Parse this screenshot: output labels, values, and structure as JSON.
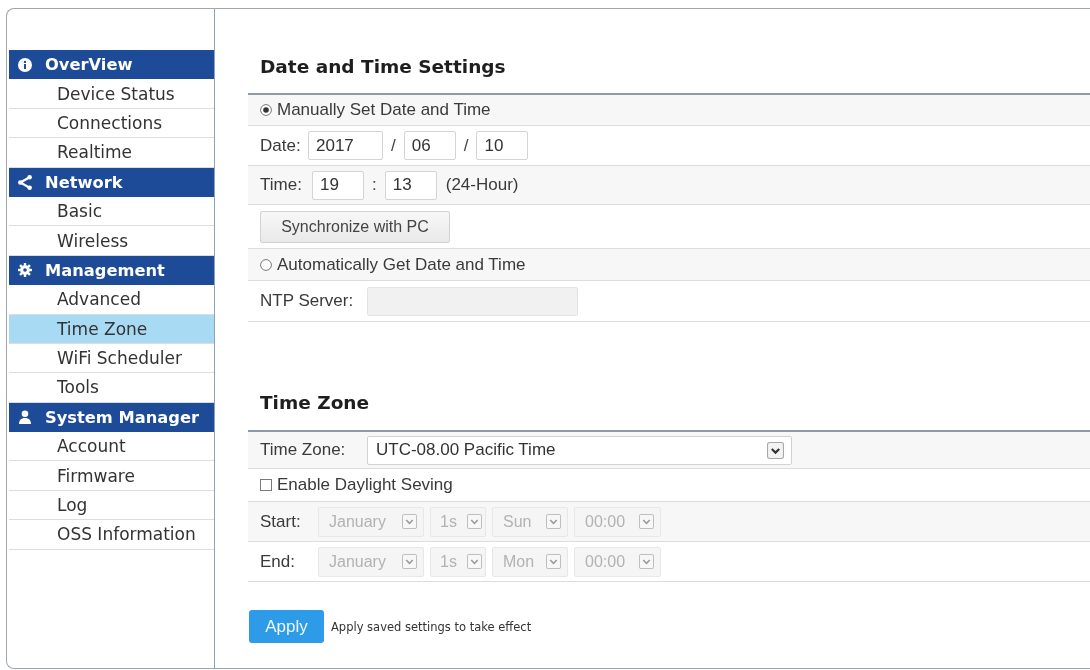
{
  "sidebar": {
    "groups": [
      {
        "title": "OverView",
        "items": [
          {
            "label": "Device Status",
            "selected": false
          },
          {
            "label": "Connections",
            "selected": false
          },
          {
            "label": "Realtime",
            "selected": false
          }
        ]
      },
      {
        "title": "Network",
        "items": [
          {
            "label": "Basic",
            "selected": false
          },
          {
            "label": "Wireless",
            "selected": false
          }
        ]
      },
      {
        "title": "Management",
        "items": [
          {
            "label": "Advanced",
            "selected": false
          },
          {
            "label": "Time Zone",
            "selected": true
          },
          {
            "label": "WiFi Scheduler",
            "selected": false
          },
          {
            "label": "Tools",
            "selected": false
          }
        ]
      },
      {
        "title": "System Manager",
        "items": [
          {
            "label": "Account",
            "selected": false
          },
          {
            "label": "Firmware",
            "selected": false
          },
          {
            "label": "Log",
            "selected": false
          },
          {
            "label": "OSS Information",
            "selected": false
          }
        ]
      }
    ]
  },
  "date_time_settings": {
    "title": "Date and Time Settings",
    "manual_option": {
      "label": "Manually Set Date and Time",
      "selected": true
    },
    "date": {
      "label": "Date:",
      "fields": [
        {
          "value": "2017"
        },
        {
          "separator": "/",
          "value": "06"
        },
        {
          "separator": "/",
          "value": "10"
        }
      ]
    },
    "time": {
      "label": "Time:",
      "fields": [
        {
          "value": "19"
        },
        {
          "separator": ":",
          "value": "13"
        }
      ],
      "note": "(24-Hour)"
    },
    "sync_button": "Synchronize with PC",
    "auto_option": {
      "label": "Automatically Get Date and Time",
      "selected": false
    },
    "ntp_server": {
      "label": "NTP Server:",
      "disabled": true
    }
  },
  "time_zone": {
    "title": "Time Zone",
    "zone": {
      "label": "Time Zone:",
      "value": "UTC-08.00 Pacific Time"
    },
    "daylight_saving": {
      "label": "Enable Daylight Seving",
      "checked": false
    },
    "ranges": [
      {
        "label": "Start:",
        "disabled": true,
        "selects": [
          "January",
          "1s",
          "Sun",
          "00:00"
        ]
      },
      {
        "label": "End:",
        "disabled": true,
        "selects": [
          "January",
          "1s",
          "Mon",
          "00:00"
        ]
      }
    ]
  },
  "apply_button": "Apply",
  "apply_note": "Apply saved settings to take effect"
}
